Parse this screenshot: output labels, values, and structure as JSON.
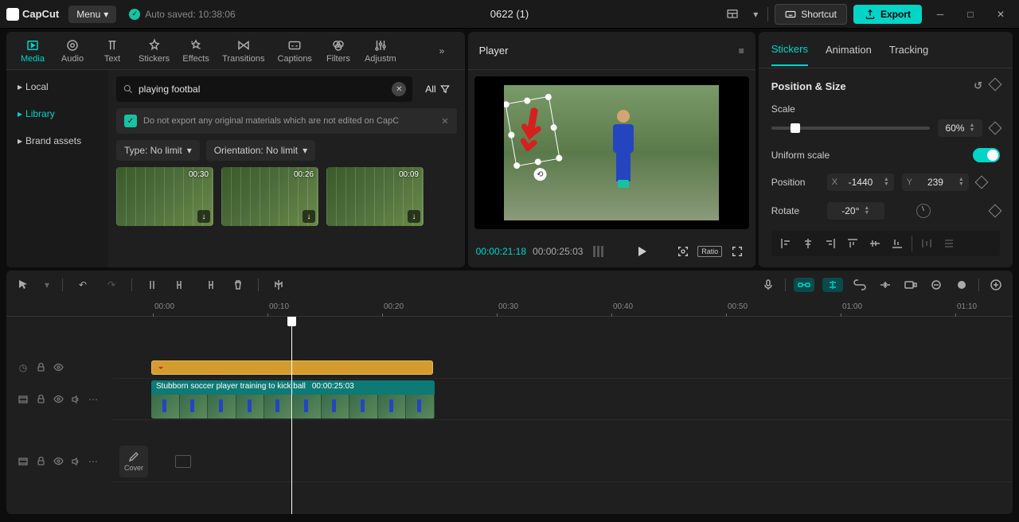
{
  "app": {
    "name": "CapCut",
    "menu_label": "Menu",
    "autosave": "Auto saved: 10:38:06",
    "project_title": "0622 (1)"
  },
  "titlebar": {
    "shortcut_label": "Shortcut",
    "export_label": "Export"
  },
  "media_tabs": [
    {
      "label": "Media",
      "active": true
    },
    {
      "label": "Audio"
    },
    {
      "label": "Text"
    },
    {
      "label": "Stickers"
    },
    {
      "label": "Effects"
    },
    {
      "label": "Transitions"
    },
    {
      "label": "Captions"
    },
    {
      "label": "Filters"
    },
    {
      "label": "Adjustm"
    }
  ],
  "left_sidebar": [
    {
      "label": "Local"
    },
    {
      "label": "Library",
      "active": true
    },
    {
      "label": "Brand assets"
    }
  ],
  "search": {
    "value": "playing footbal",
    "all_label": "All"
  },
  "notice": "Do not export any original materials which are not edited on CapC",
  "filters": {
    "type": "Type: No limit",
    "orientation": "Orientation: No limit"
  },
  "thumbs": [
    {
      "dur": "00:30"
    },
    {
      "dur": "00:26"
    },
    {
      "dur": "00:09"
    }
  ],
  "player": {
    "title": "Player",
    "current": "00:00:21:18",
    "duration": "00:00:25:03",
    "ratio": "Ratio"
  },
  "inspector": {
    "tabs": [
      {
        "label": "Stickers",
        "active": true
      },
      {
        "label": "Animation"
      },
      {
        "label": "Tracking"
      }
    ],
    "section_title": "Position & Size",
    "scale_label": "Scale",
    "scale_value": "60%",
    "uniform_label": "Uniform scale",
    "position_label": "Position",
    "pos_x_label": "X",
    "pos_x": "-1440",
    "pos_y_label": "Y",
    "pos_y": "239",
    "rotate_label": "Rotate",
    "rotate_value": "-20°"
  },
  "timeline": {
    "ruler": [
      "00:00",
      "00:10",
      "00:20",
      "00:30",
      "00:40",
      "00:50",
      "01:00",
      "01:10"
    ],
    "cover_label": "Cover",
    "video_clip": {
      "title": "Stubborn soccer player training to kick ball",
      "dur": "00:00:25:03"
    }
  }
}
